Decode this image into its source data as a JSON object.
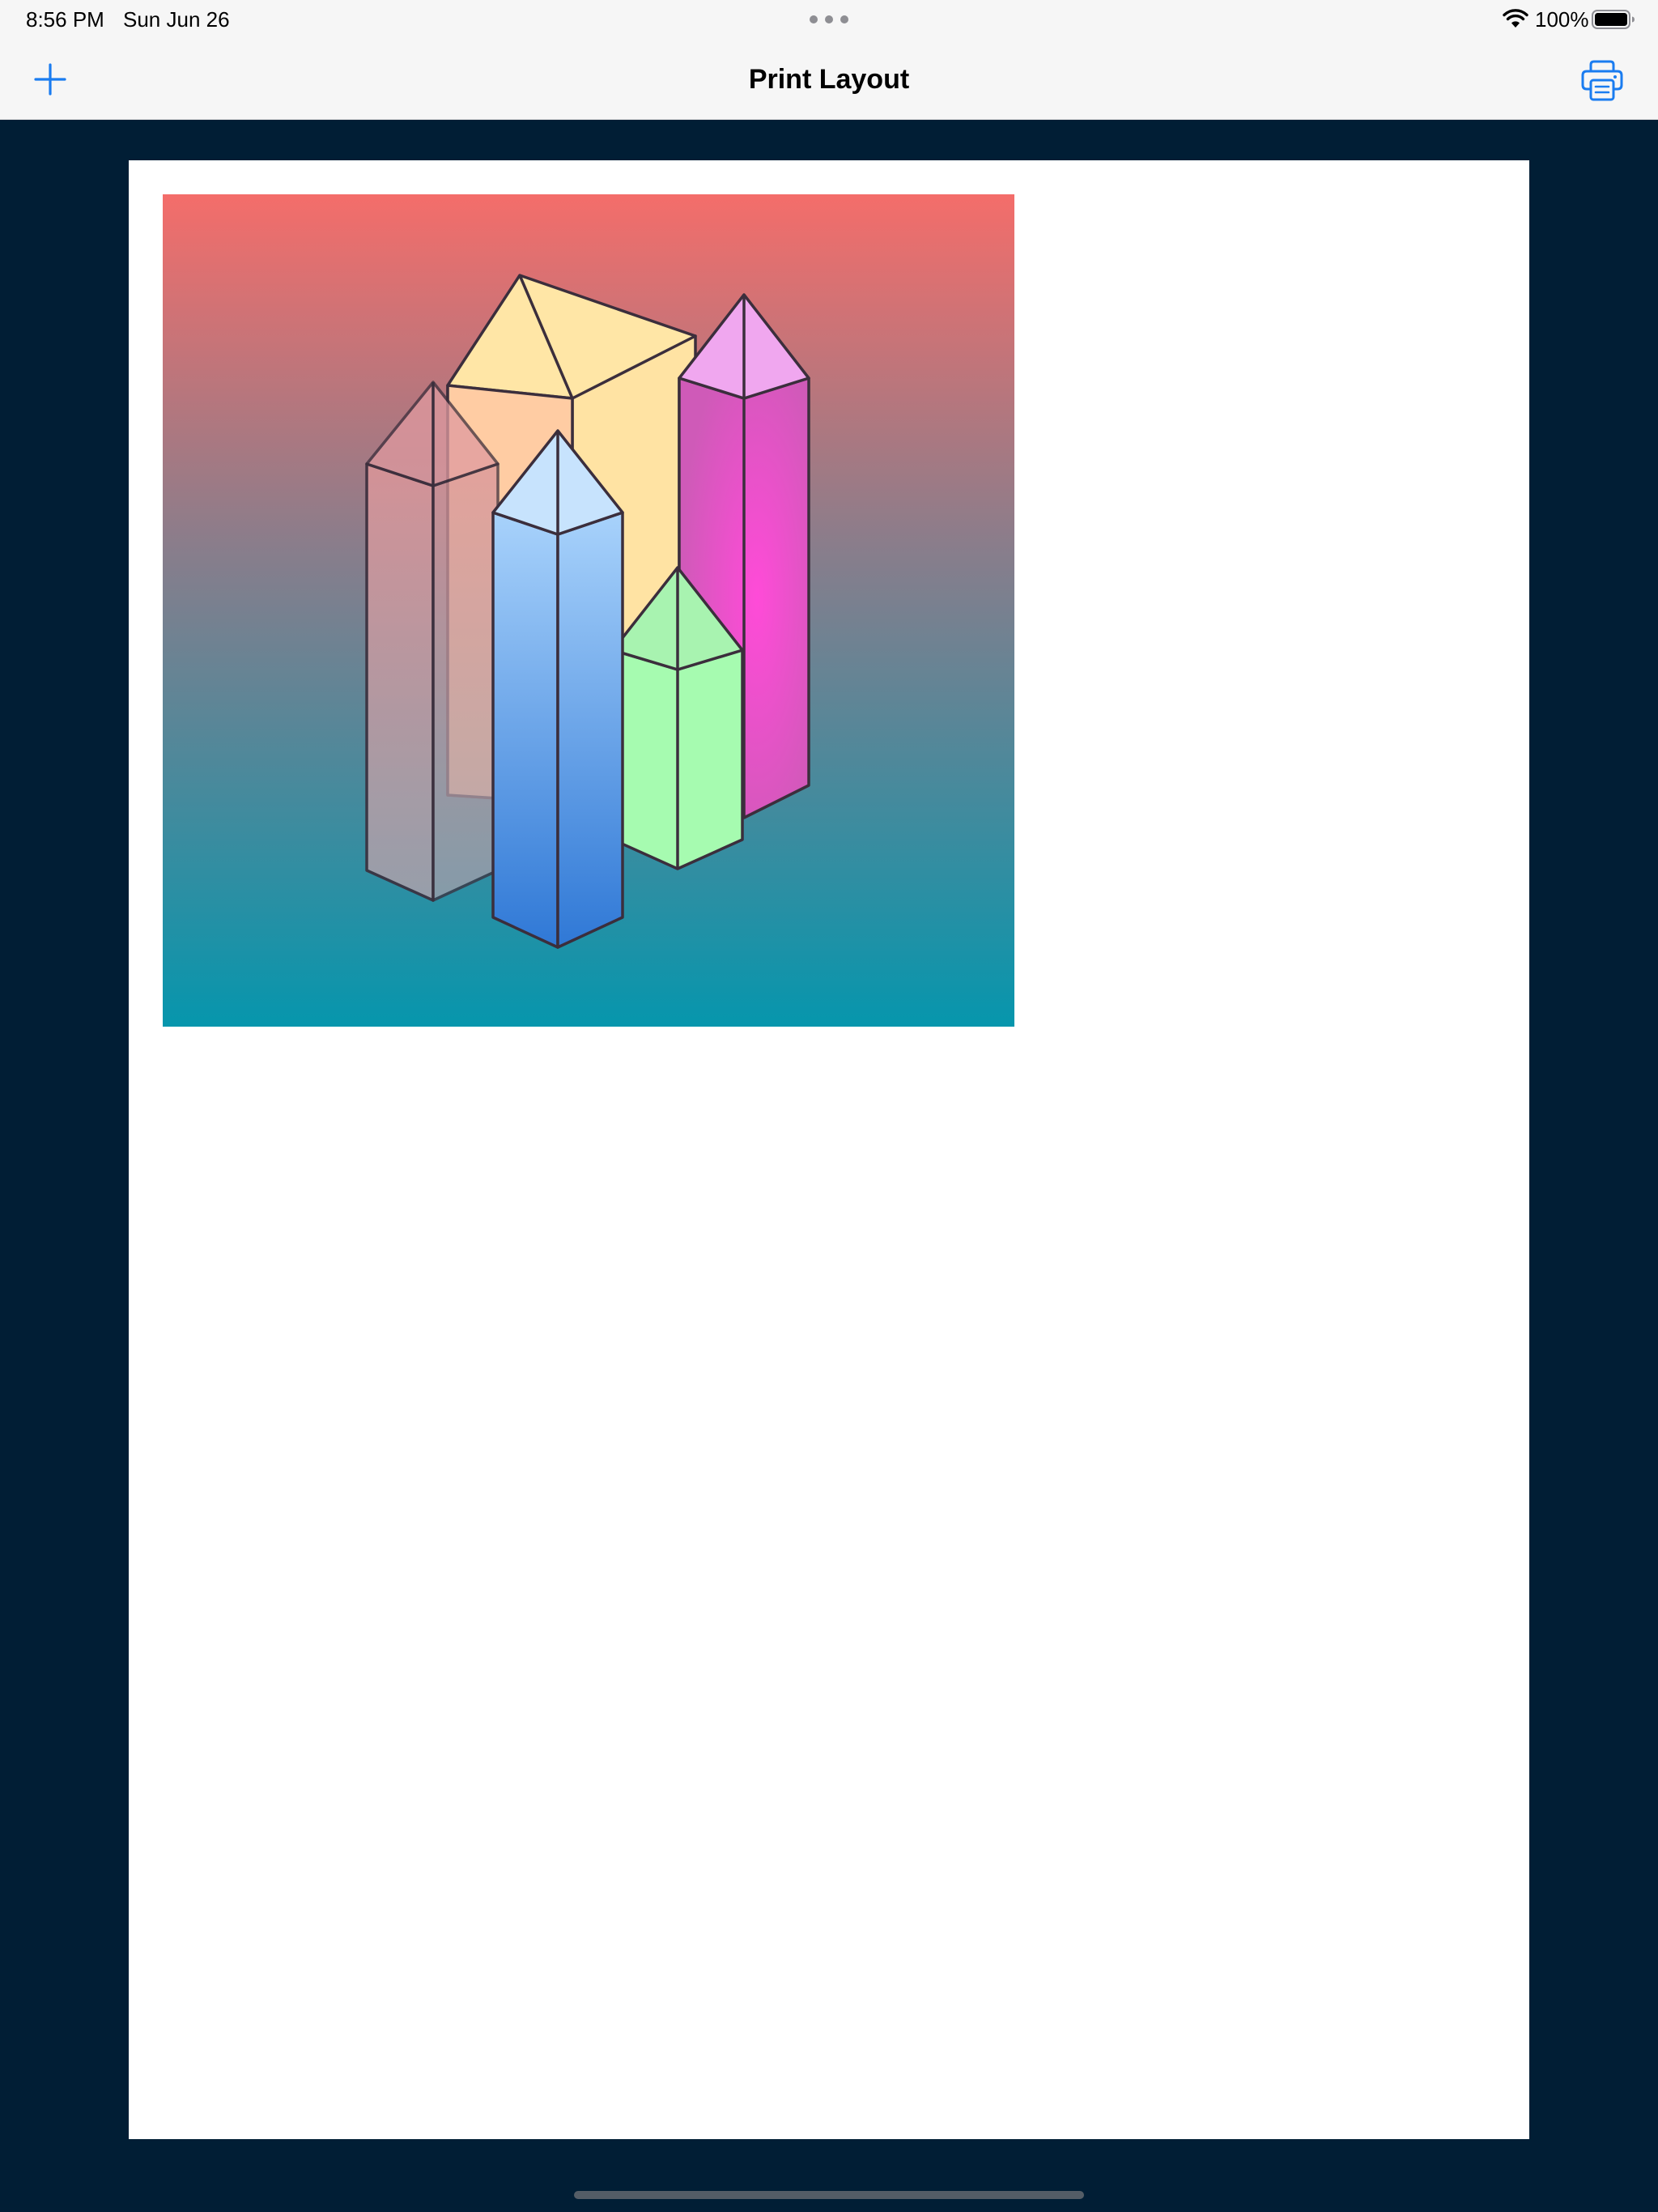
{
  "status_bar": {
    "time": "8:56 PM",
    "date": "Sun Jun 26",
    "battery_percent": "100%",
    "battery_level": 1.0,
    "icons": [
      "wifi-icon",
      "battery-icon"
    ]
  },
  "nav_bar": {
    "title": "Print Layout",
    "left_button_icon": "plus-icon",
    "right_button_icon": "printer-icon"
  },
  "colors": {
    "accent": "#1a7cf0",
    "page_background": "#011e35",
    "bar_background": "#f6f6f6",
    "paper": "#ffffff",
    "image_gradient_top": "#f46d6a",
    "image_gradient_bottom": "#0696ad"
  },
  "page": {
    "image_description_icon": "crystal-towers-illustration"
  }
}
